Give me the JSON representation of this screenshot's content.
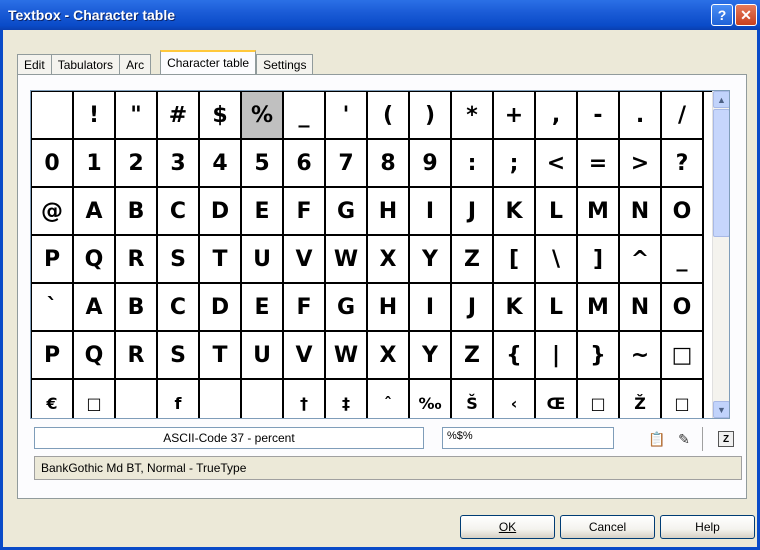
{
  "window": {
    "title": "Textbox - Character table",
    "help_label": "?",
    "close_label": "✕"
  },
  "tabs": [
    {
      "label": "Edit"
    },
    {
      "label": "Tabulators"
    },
    {
      "label": "Arc"
    },
    {
      "label": "Character table",
      "active": true
    },
    {
      "label": "Settings"
    }
  ],
  "grid": {
    "selected_index": 5,
    "rows": [
      [
        " ",
        "!",
        "\"",
        "#",
        "$",
        "%",
        "_",
        "'",
        "(",
        ")",
        "*",
        "+",
        ",",
        "-",
        ".",
        "/"
      ],
      [
        "0",
        "1",
        "2",
        "3",
        "4",
        "5",
        "6",
        "7",
        "8",
        "9",
        ":",
        ";",
        "<",
        "=",
        ">",
        "?"
      ],
      [
        "@",
        "A",
        "B",
        "C",
        "D",
        "E",
        "F",
        "G",
        "H",
        "I",
        "J",
        "K",
        "L",
        "M",
        "N",
        "O"
      ],
      [
        "P",
        "Q",
        "R",
        "S",
        "T",
        "U",
        "V",
        "W",
        "X",
        "Y",
        "Z",
        "[",
        "\\",
        "]",
        "^",
        "_"
      ],
      [
        "`",
        "A",
        "B",
        "C",
        "D",
        "E",
        "F",
        "G",
        "H",
        "I",
        "J",
        "K",
        "L",
        "M",
        "N",
        "O"
      ],
      [
        "P",
        "Q",
        "R",
        "S",
        "T",
        "U",
        "V",
        "W",
        "X",
        "Y",
        "Z",
        "{",
        "|",
        "}",
        "~",
        "□"
      ],
      [
        "€",
        "□",
        " ",
        "f",
        " ",
        " ",
        "†",
        "‡",
        "ˆ",
        "‰",
        "Š",
        "‹",
        "Œ",
        "□",
        "Ž",
        "□"
      ]
    ]
  },
  "info": {
    "ascii_text": "ASCII-Code 37  -  percent",
    "code_value": "%$%"
  },
  "font_info": "BankGothic Md BT, Normal  -  TrueType",
  "buttons": {
    "ok": "OK",
    "cancel": "Cancel",
    "help": "Help"
  },
  "icons": {
    "paste": "paste-icon",
    "erase": "erase-icon",
    "z": "Z"
  },
  "colors": {
    "titlebar": "#0a4bc8",
    "selected_cell": "#c0c0c0",
    "tab_active_accent": "#ffc83c"
  }
}
